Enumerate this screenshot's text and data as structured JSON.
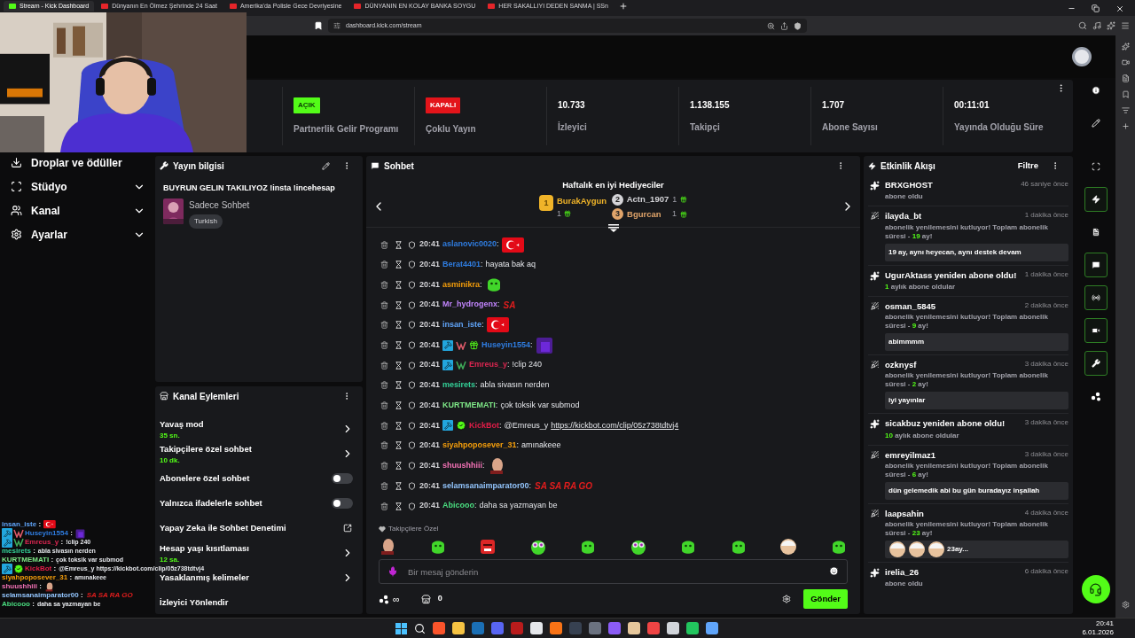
{
  "browser": {
    "tabs": [
      {
        "title": "Stream - Kick Dashboard",
        "selected": true
      },
      {
        "title": "Dünyanın En Ölmez Şehrinde 24 Saat",
        "selected": false
      },
      {
        "title": "Amerika'da Polisle Gece Devriyesine",
        "selected": false
      },
      {
        "title": "DÜNYANIN EN KOLAY BANKA SOYGU",
        "selected": false
      },
      {
        "title": "HER SAKALLIYI DEDEN SANMA | SSn",
        "selected": false
      }
    ],
    "address": "dashboard.kick.com/stream"
  },
  "sidebar": [
    {
      "label": "Droplar ve ödüller",
      "expandable": false
    },
    {
      "label": "Stüdyo",
      "expandable": true
    },
    {
      "label": "Kanal",
      "expandable": true
    },
    {
      "label": "Ayarlar",
      "expandable": true
    }
  ],
  "stats": [
    {
      "kind": "badge",
      "badge": "AÇIK",
      "on": true,
      "label": "Partnerlik Gelir Programı"
    },
    {
      "kind": "badge",
      "badge": "KAPALI",
      "on": false,
      "label": "Çoklu Yayın"
    },
    {
      "kind": "number",
      "value": "10.733",
      "label": "İzleyici"
    },
    {
      "kind": "number",
      "value": "1.138.155",
      "label": "Takipçi"
    },
    {
      "kind": "number",
      "value": "1.707",
      "label": "Abone Sayısı"
    },
    {
      "kind": "number",
      "value": "00:11:01",
      "label": "Yayında Olduğu Süre"
    }
  ],
  "stream_info": {
    "title": "Yayın bilgisi",
    "stream_title": "BUYRUN GELIN TAKILIYOZ !insta !incehesap",
    "category": "Sadece Sohbet",
    "tag": "Turkish"
  },
  "channel_actions": {
    "title": "Kanal Eylemleri",
    "items": [
      {
        "kind": "nav",
        "label": "Yavaş mod",
        "value": "35 sn."
      },
      {
        "kind": "nav",
        "label": "Takipçilere özel sohbet",
        "value": "10 dk."
      },
      {
        "kind": "toggle",
        "label": "Abonelere özel sohbet",
        "on": false
      },
      {
        "kind": "toggle",
        "label": "Yalnızca ifadelerle sohbet",
        "on": false
      },
      {
        "kind": "external",
        "label": "Yapay Zeka ile Sohbet Denetimi"
      },
      {
        "kind": "nav",
        "label": "Hesap yaşı kısıtlaması",
        "value": "12 sa."
      },
      {
        "kind": "nav",
        "label": "Yasaklanmış kelimeler"
      },
      {
        "kind": "plain",
        "label": "İzleyici Yönlendir"
      }
    ]
  },
  "chat": {
    "title": "Sohbet",
    "gifters_title": "Haftalık en iyi Hediyeciler",
    "gifters": [
      {
        "rank": "1",
        "name": "BurakAygun",
        "count": "1",
        "color": "#f0b429"
      },
      {
        "rank": "2",
        "name": "Actn_1907",
        "count": "1",
        "color": "#d4d4d8"
      },
      {
        "rank": "3",
        "name": "Bgurcan",
        "count": "1",
        "color": "#e0a46a"
      }
    ],
    "separator": ":",
    "messages": [
      {
        "time": "20:41",
        "user": "aslanovic0020",
        "color": "#2f7de1",
        "content": [
          {
            "kind": "flag"
          }
        ]
      },
      {
        "time": "20:41",
        "user": "Berat4401",
        "color": "#2f7de1",
        "content": [
          {
            "kind": "text",
            "text": "hayata bak aq"
          }
        ]
      },
      {
        "time": "20:41",
        "user": "asminikra",
        "color": "#f59e0b",
        "content": [
          {
            "kind": "blob"
          }
        ]
      },
      {
        "time": "20:41",
        "user": "Mr_hydrogenx",
        "color": "#c084fc",
        "content": [
          {
            "kind": "word",
            "text": "SA"
          }
        ]
      },
      {
        "time": "20:41",
        "user": "insan_iste",
        "color": "#60a5fa",
        "content": [
          {
            "kind": "flag"
          }
        ]
      },
      {
        "time": "20:41",
        "user": "Huseyin1554",
        "color": "#2f7de1",
        "badges": [
          {
            "kind": "mod"
          },
          {
            "kind": "crest",
            "color": "#e25c6b"
          },
          {
            "kind": "gift"
          }
        ],
        "content": [
          {
            "kind": "square"
          }
        ]
      },
      {
        "time": "20:41",
        "user": "Emreus_y",
        "color": "#dc2651",
        "badges": [
          {
            "kind": "mod"
          },
          {
            "kind": "crest",
            "color": "#3fae5a"
          }
        ],
        "content": [
          {
            "kind": "text",
            "text": "!clip 240"
          }
        ]
      },
      {
        "time": "20:41",
        "user": "mesirets",
        "color": "#34d399",
        "content": [
          {
            "kind": "text",
            "text": "abla sivasın nerden"
          }
        ]
      },
      {
        "time": "20:41",
        "user": "KURTMEMATI",
        "color": "#7ee787",
        "content": [
          {
            "kind": "text",
            "text": "çok toksik var submod"
          }
        ]
      },
      {
        "time": "20:41",
        "user": "KickBot",
        "color": "#e11d48",
        "badges": [
          {
            "kind": "mod"
          },
          {
            "kind": "verified"
          }
        ],
        "content": [
          {
            "kind": "text",
            "text": "@Emreus_y"
          },
          {
            "kind": "link",
            "text": "https://kickbot.com/clip/05z738tdtvj4"
          }
        ]
      },
      {
        "time": "20:41",
        "user": "siyahpoposever_31",
        "color": "#f59e0b",
        "content": [
          {
            "kind": "text",
            "text": "amınakeee"
          }
        ]
      },
      {
        "time": "20:41",
        "user": "shuushhiii",
        "color": "#f472b6",
        "content": [
          {
            "kind": "sticker"
          }
        ]
      },
      {
        "time": "20:41",
        "user": "selamsanaimparator00",
        "color": "#93c5fd",
        "content": [
          {
            "kind": "word",
            "text": "SA SA RA GO"
          }
        ]
      },
      {
        "time": "20:41",
        "user": "Abicooo",
        "color": "#4ade80",
        "content": [
          {
            "kind": "text",
            "text": "daha sa yazmayan be"
          }
        ]
      }
    ],
    "emote_section": "Takipçilere Özel",
    "emotes": [
      {
        "kind": "sticker"
      },
      {
        "kind": "blob"
      },
      {
        "kind": "angry"
      },
      {
        "kind": "glasses"
      },
      {
        "kind": "blob"
      },
      {
        "kind": "glasses"
      },
      {
        "kind": "blob"
      },
      {
        "kind": "blob"
      },
      {
        "kind": "face"
      },
      {
        "kind": "blob"
      }
    ],
    "placeholder": "Bir mesaj gönderin",
    "points": "∞",
    "store_count": "0",
    "send": "Gönder"
  },
  "events": {
    "title": "Etkinlik Akışı",
    "filter": "Filtre",
    "items": [
      {
        "kind": "sub",
        "user": "BRXGHOST",
        "time": "46 saniye önce",
        "note": "abone oldu"
      },
      {
        "kind": "resub",
        "user": "ilayda_bt",
        "time": "1 dakika önce",
        "note_before": "abonelik yenilemesini kutluyor! Toplam abonelik süresi - ",
        "months": "19",
        "note_after": " ay!",
        "message": "19 ay, aynı heyecan, aynı destek devam"
      },
      {
        "kind": "resub_title",
        "title": "UgurAktass yeniden abone oldu!",
        "time": "1 dakika önce",
        "months": "1",
        "note_after": " aylık abone oldular"
      },
      {
        "kind": "resub",
        "user": "osman_5845",
        "time": "2 dakika önce",
        "note_before": "abonelik yenilemesini kutluyor! Toplam abonelik süresi - ",
        "months": "9",
        "note_after": " ay!",
        "message": "abimmmm"
      },
      {
        "kind": "resub",
        "user": "ozknysf",
        "time": "3 dakika önce",
        "note_before": "abonelik yenilemesini kutluyor! Toplam abonelik süresi - ",
        "months": "2",
        "note_after": " ay!",
        "message": "iyi yayınlar"
      },
      {
        "kind": "resub_title",
        "title": "sicakbuz yeniden abone oldu!",
        "time": "3 dakika önce",
        "months": "10",
        "note_after": " aylık abone oldular"
      },
      {
        "kind": "resub",
        "user": "emreyilmaz1",
        "time": "3 dakika önce",
        "note_before": "abonelik yenilemesini kutluyor! Toplam abonelik süresi - ",
        "months": "6",
        "note_after": " ay!",
        "message": "dün gelemedik abi bu gün buradayız inşallah"
      },
      {
        "kind": "resub",
        "user": "laapsahin",
        "time": "4 dakika önce",
        "note_before": "abonelik yenilemesini kutluyor! Toplam abonelik süresi - ",
        "months": "23",
        "note_after": " ay!",
        "message_emotes": [
          {
            "kind": "face"
          },
          {
            "kind": "face"
          },
          {
            "kind": "face"
          }
        ],
        "message": "23ay..."
      },
      {
        "kind": "sub",
        "user": "irelia_26",
        "time": "6 dakika önce",
        "note": "abone oldu"
      }
    ]
  },
  "rail": [
    {
      "active": false
    },
    {
      "active": false
    },
    {
      "active": false
    },
    {
      "active": true
    },
    {
      "active": false
    },
    {
      "active": true
    },
    {
      "active": true
    },
    {
      "active": true
    },
    {
      "active": true
    },
    {
      "active": false
    }
  ],
  "overlay_chat": {
    "separator": ":",
    "lines": [
      {
        "user": "insan_iste",
        "color": "#60a5fa",
        "content": [
          {
            "kind": "flag"
          }
        ]
      },
      {
        "user": "Huseyin1554",
        "color": "#2f7de1",
        "badges": [
          {
            "kind": "mod"
          },
          {
            "kind": "crest",
            "color": "#e25c6b"
          }
        ],
        "content": [
          {
            "kind": "square"
          }
        ]
      },
      {
        "user": "Emreus_y",
        "color": "#dc2651",
        "badges": [
          {
            "kind": "mod"
          },
          {
            "kind": "crest",
            "color": "#3fae5a"
          }
        ],
        "content": [
          {
            "kind": "text",
            "text": "!clip 240"
          }
        ]
      },
      {
        "user": "mesirets",
        "color": "#34d399",
        "content": [
          {
            "kind": "text",
            "text": "abla sivasın nerden"
          }
        ]
      },
      {
        "user": "KURTMEMATI",
        "color": "#7ee787",
        "content": [
          {
            "kind": "text",
            "text": "çok toksik var submod"
          }
        ]
      },
      {
        "user": "KickBot",
        "color": "#e11d48",
        "badges": [
          {
            "kind": "mod"
          },
          {
            "kind": "verified"
          }
        ],
        "content": [
          {
            "kind": "text",
            "text": "@Emreus_y https://kickbot.com/clip/05z738tdtvj4"
          }
        ]
      },
      {
        "user": "siyahpoposever_31",
        "color": "#f59e0b",
        "content": [
          {
            "kind": "text",
            "text": "amınakeee"
          }
        ]
      },
      {
        "user": "shuushhiii",
        "color": "#f472b6",
        "content": [
          {
            "kind": "sticker"
          }
        ]
      },
      {
        "user": "selamsanaimparator00",
        "color": "#93c5fd",
        "content": [
          {
            "kind": "word",
            "text": "SA SA RA GO"
          }
        ]
      },
      {
        "user": "Abicooo",
        "color": "#4ade80",
        "content": [
          {
            "kind": "text",
            "text": "daha sa yazmayan be"
          }
        ]
      }
    ]
  },
  "taskbar": {
    "time": "20:41",
    "date": "6.01.2026"
  }
}
